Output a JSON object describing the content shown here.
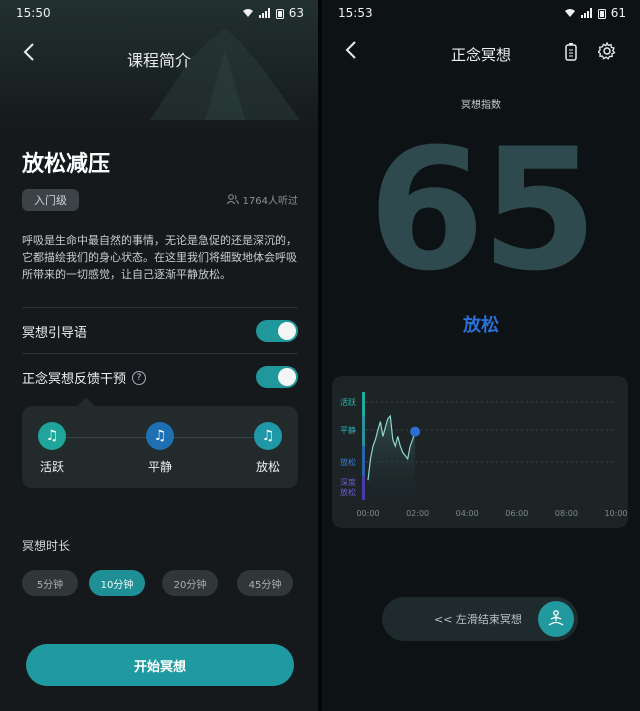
{
  "left": {
    "status": {
      "time": "15:50",
      "battery": "63"
    },
    "header": {
      "title": "课程简介"
    },
    "course": {
      "title": "放松减压",
      "level": "入门级",
      "listeners": "1764人听过",
      "description": "呼吸是生命中最自然的事情，无论是急促的还是深沉的，它都描绘我们的身心状态。在这里我们将细致地体会呼吸所带来的一切感觉，让自己逐渐平静放松。"
    },
    "settings": [
      {
        "label": "冥想引导语",
        "on": true
      },
      {
        "label": "正念冥想反馈干预",
        "on": true,
        "help": "?"
      }
    ],
    "modes": [
      {
        "label": "活跃",
        "icon": "music-note-icon",
        "color": "#1fa59c"
      },
      {
        "label": "平静",
        "icon": "music-note-icon",
        "color": "#1f6fb3"
      },
      {
        "label": "放松",
        "icon": "music-note-icon",
        "color": "#1f98a8"
      }
    ],
    "duration": {
      "title": "冥想时长",
      "options": [
        "5分钟",
        "10分钟",
        "20分钟",
        "45分钟"
      ],
      "selected": "10分钟"
    },
    "start_button": "开始冥想"
  },
  "right": {
    "status": {
      "time": "15:53",
      "battery": "61"
    },
    "header": {
      "title": "正念冥想"
    },
    "index_label": "冥想指数",
    "index_value": "65",
    "state": "放松",
    "slide_text": "<< 左滑结束冥想",
    "colors": {
      "accent": "#1e9aa0",
      "state": "#2b6fd6"
    },
    "chart_data": {
      "type": "line",
      "y_categories": [
        "活跃",
        "平静",
        "放松",
        "深度放松"
      ],
      "x_ticks": [
        "00:00",
        "02:00",
        "04:00",
        "06:00",
        "08:00",
        "10:00"
      ],
      "x_range_min": [
        0,
        10
      ],
      "series": [
        {
          "x": [
            0.0,
            0.1,
            0.2,
            0.3,
            0.4,
            0.5,
            0.6,
            0.7,
            0.8,
            0.9,
            1.0,
            1.1,
            1.2,
            1.3,
            1.4,
            1.5,
            1.6,
            1.7,
            1.8,
            1.9
          ],
          "y": [
            3.7,
            2.9,
            2.5,
            2.3,
            2.0,
            1.7,
            2.2,
            1.9,
            1.6,
            1.5,
            2.3,
            2.5,
            2.2,
            2.5,
            2.7,
            2.8,
            2.9,
            2.5,
            2.3,
            2.05
          ]
        }
      ]
    }
  }
}
